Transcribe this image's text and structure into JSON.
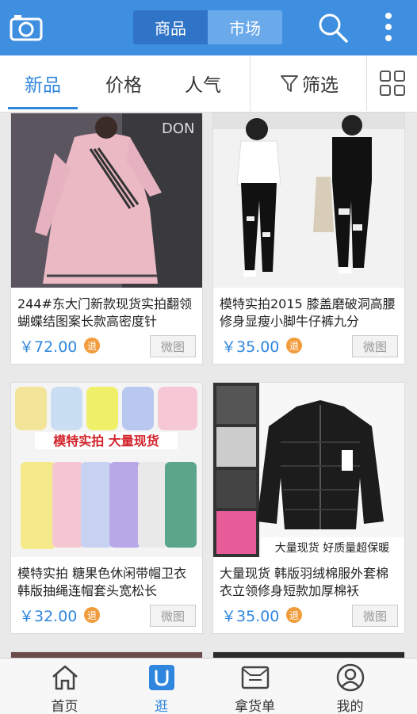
{
  "header": {
    "segments": [
      "商品",
      "市场"
    ],
    "active_segment": 0
  },
  "tabs": {
    "items": [
      "新品",
      "价格",
      "人气"
    ],
    "filter_label": "筛选",
    "active": 0
  },
  "products": [
    {
      "title": "244#东大门新款现货实拍翻领蝴蝶结图案长款高密度针",
      "price": "￥72.00",
      "badge": "退",
      "action": "微图"
    },
    {
      "title": "模特实拍2015 膝盖磨破洞高腰修身显瘦小脚牛仔裤九分",
      "price": "￥35.00",
      "badge": "退",
      "action": "微图"
    },
    {
      "title": "模特实拍 糖果色休闲带帽卫衣韩版抽绳连帽套头宽松长",
      "price": "￥32.00",
      "badge": "退",
      "action": "微图",
      "overlay": "模特实拍 大量现货"
    },
    {
      "title": "大量现货 韩版羽绒棉服外套棉衣立领修身短款加厚棉袄",
      "price": "￥35.00",
      "badge": "退",
      "action": "微图",
      "overlay": "大量现货 好质量超保暖"
    }
  ],
  "bottom_nav": {
    "items": [
      "首页",
      "逛",
      "拿货单",
      "我的"
    ],
    "active": 1
  },
  "colors": {
    "primary": "#3f8fe0",
    "accent": "#2f86de",
    "badge": "#f19b3b"
  }
}
